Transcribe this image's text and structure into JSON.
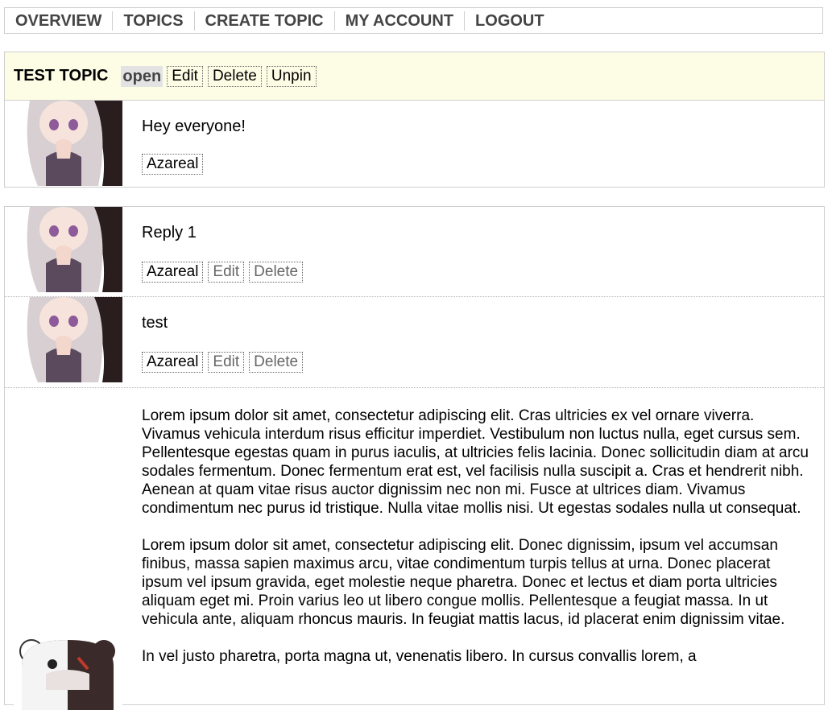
{
  "nav": {
    "items": [
      "OVERVIEW",
      "TOPICS",
      "CREATE TOPIC",
      "MY ACCOUNT",
      "LOGOUT"
    ]
  },
  "topic": {
    "title": "TEST TOPIC",
    "status": "open",
    "edit_label": "Edit",
    "delete_label": "Delete",
    "unpin_label": "Unpin"
  },
  "opening_post": {
    "text": "Hey everyone!",
    "author": "Azareal"
  },
  "replies": [
    {
      "text": "Reply 1",
      "author": "Azareal",
      "edit_label": "Edit",
      "delete_label": "Delete"
    },
    {
      "text": "test",
      "author": "Azareal",
      "edit_label": "Edit",
      "delete_label": "Delete"
    }
  ],
  "long_post": {
    "paragraphs": [
      "Lorem ipsum dolor sit amet, consectetur adipiscing elit. Cras ultricies ex vel ornare viverra. Vivamus vehicula interdum risus efficitur imperdiet. Vestibulum non luctus nulla, eget cursus sem. Pellentesque egestas quam in purus iaculis, at ultricies felis lacinia. Donec sollicitudin diam at arcu sodales fermentum. Donec fermentum erat est, vel facilisis nulla suscipit a. Cras et hendrerit nibh. Aenean at quam vitae risus auctor dignissim nec non mi. Fusce at ultrices diam. Vivamus condimentum nec purus id tristique. Nulla vitae mollis nisi. Ut egestas sodales nulla ut consequat.",
      "Lorem ipsum dolor sit amet, consectetur adipiscing elit. Donec dignissim, ipsum vel accumsan finibus, massa sapien maximus arcu, vitae condimentum turpis tellus at urna. Donec placerat ipsum vel ipsum gravida, eget molestie neque pharetra. Donec et lectus et diam porta ultricies aliquam eget mi. Proin varius leo ut libero congue mollis. Pellentesque a feugiat massa. In ut vehicula ante, aliquam rhoncus mauris. In feugiat mattis lacus, id placerat enim dignissim vitae.",
      "In vel justo pharetra, porta magna ut, venenatis libero. In cursus convallis lorem, a"
    ]
  }
}
